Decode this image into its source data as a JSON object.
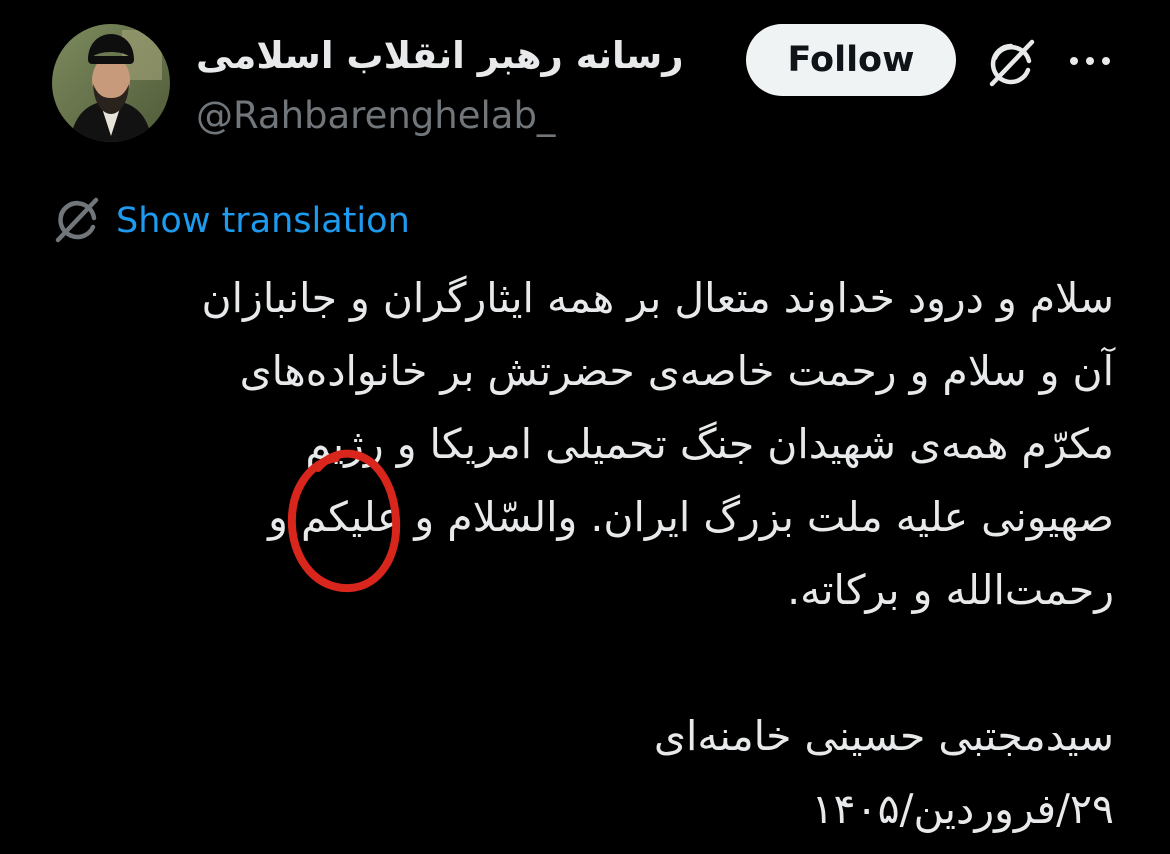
{
  "author": {
    "display_name": "رسانه رهبر انقلاب اسلامی",
    "handle": "@Rahbarenghelab_",
    "avatar_icon": "profile-photo"
  },
  "header": {
    "follow_label": "Follow",
    "grok_icon": "grok-icon",
    "more_icon": "more-options-icon"
  },
  "translation": {
    "icon": "translate-globe-icon",
    "label": "Show translation"
  },
  "tweet": {
    "lines": [
      "سلام و درود خداوند متعال بر همه ایثارگران و جانبازان",
      "آن و سلام و رحمت خاصه‌ی حضرتش بر خانواده‌های",
      "مکرّم همه‌ی شهیدان جنگ تحمیلی امریکا و رژیم",
      "صهیونی علیه ملت بزرگ ایران. والسّلام و علیکم و",
      "رحمت‌الله و برکاته."
    ],
    "signature": "سیدمجتبی حسینی خامنه‌ای",
    "date": "۲۹/فروردین/۱۴۰۵"
  },
  "colors": {
    "background": "#000000",
    "text": "#e7e9ea",
    "muted": "#71767b",
    "link": "#1d9bf0",
    "follow_bg": "#eff3f4",
    "annotation": "#d9261c"
  }
}
